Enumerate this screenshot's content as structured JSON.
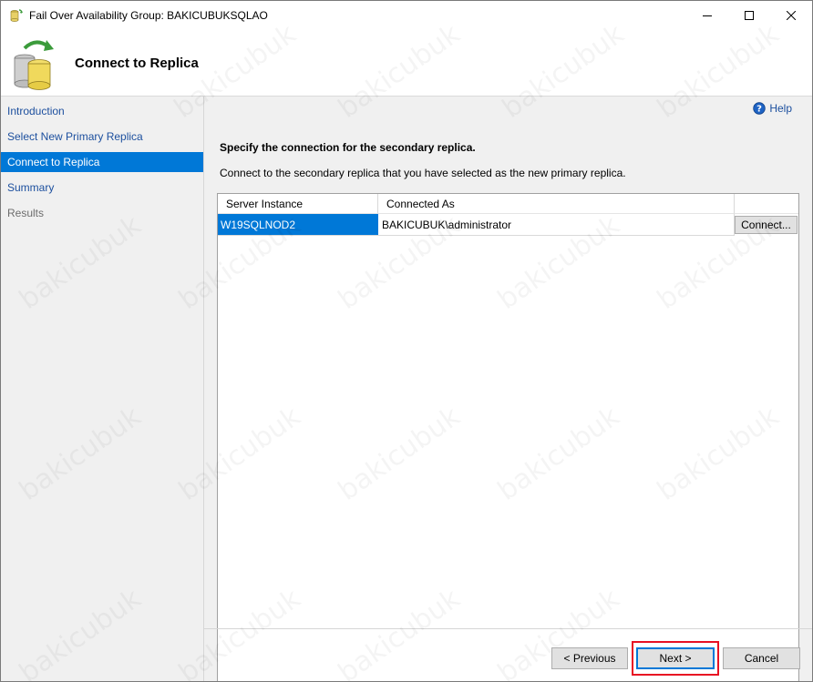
{
  "window": {
    "title": "Fail Over Availability Group: BAKICUBUKSQLAO",
    "page_title": "Connect to Replica"
  },
  "nav": {
    "items": [
      {
        "label": "Introduction",
        "state": "link"
      },
      {
        "label": "Select New Primary Replica",
        "state": "link"
      },
      {
        "label": "Connect to Replica",
        "state": "active"
      },
      {
        "label": "Summary",
        "state": "link"
      },
      {
        "label": "Results",
        "state": "disabled"
      }
    ]
  },
  "main": {
    "help_label": "Help",
    "heading": "Specify the connection for the secondary replica.",
    "description": "Connect to the secondary replica that you have selected as the new primary replica.",
    "table": {
      "columns": [
        "Server Instance",
        "Connected As"
      ],
      "rows": [
        {
          "server_instance": "W19SQLNOD2",
          "connected_as": "BAKICUBUK\\administrator",
          "action_label": "Connect..."
        }
      ]
    }
  },
  "footer": {
    "previous_label": "< Previous",
    "next_label": "Next >",
    "cancel_label": "Cancel"
  },
  "watermark": "bakicubuk",
  "colors": {
    "accent": "#0078d7",
    "link": "#1c4f9e",
    "highlight": "#e81123"
  }
}
